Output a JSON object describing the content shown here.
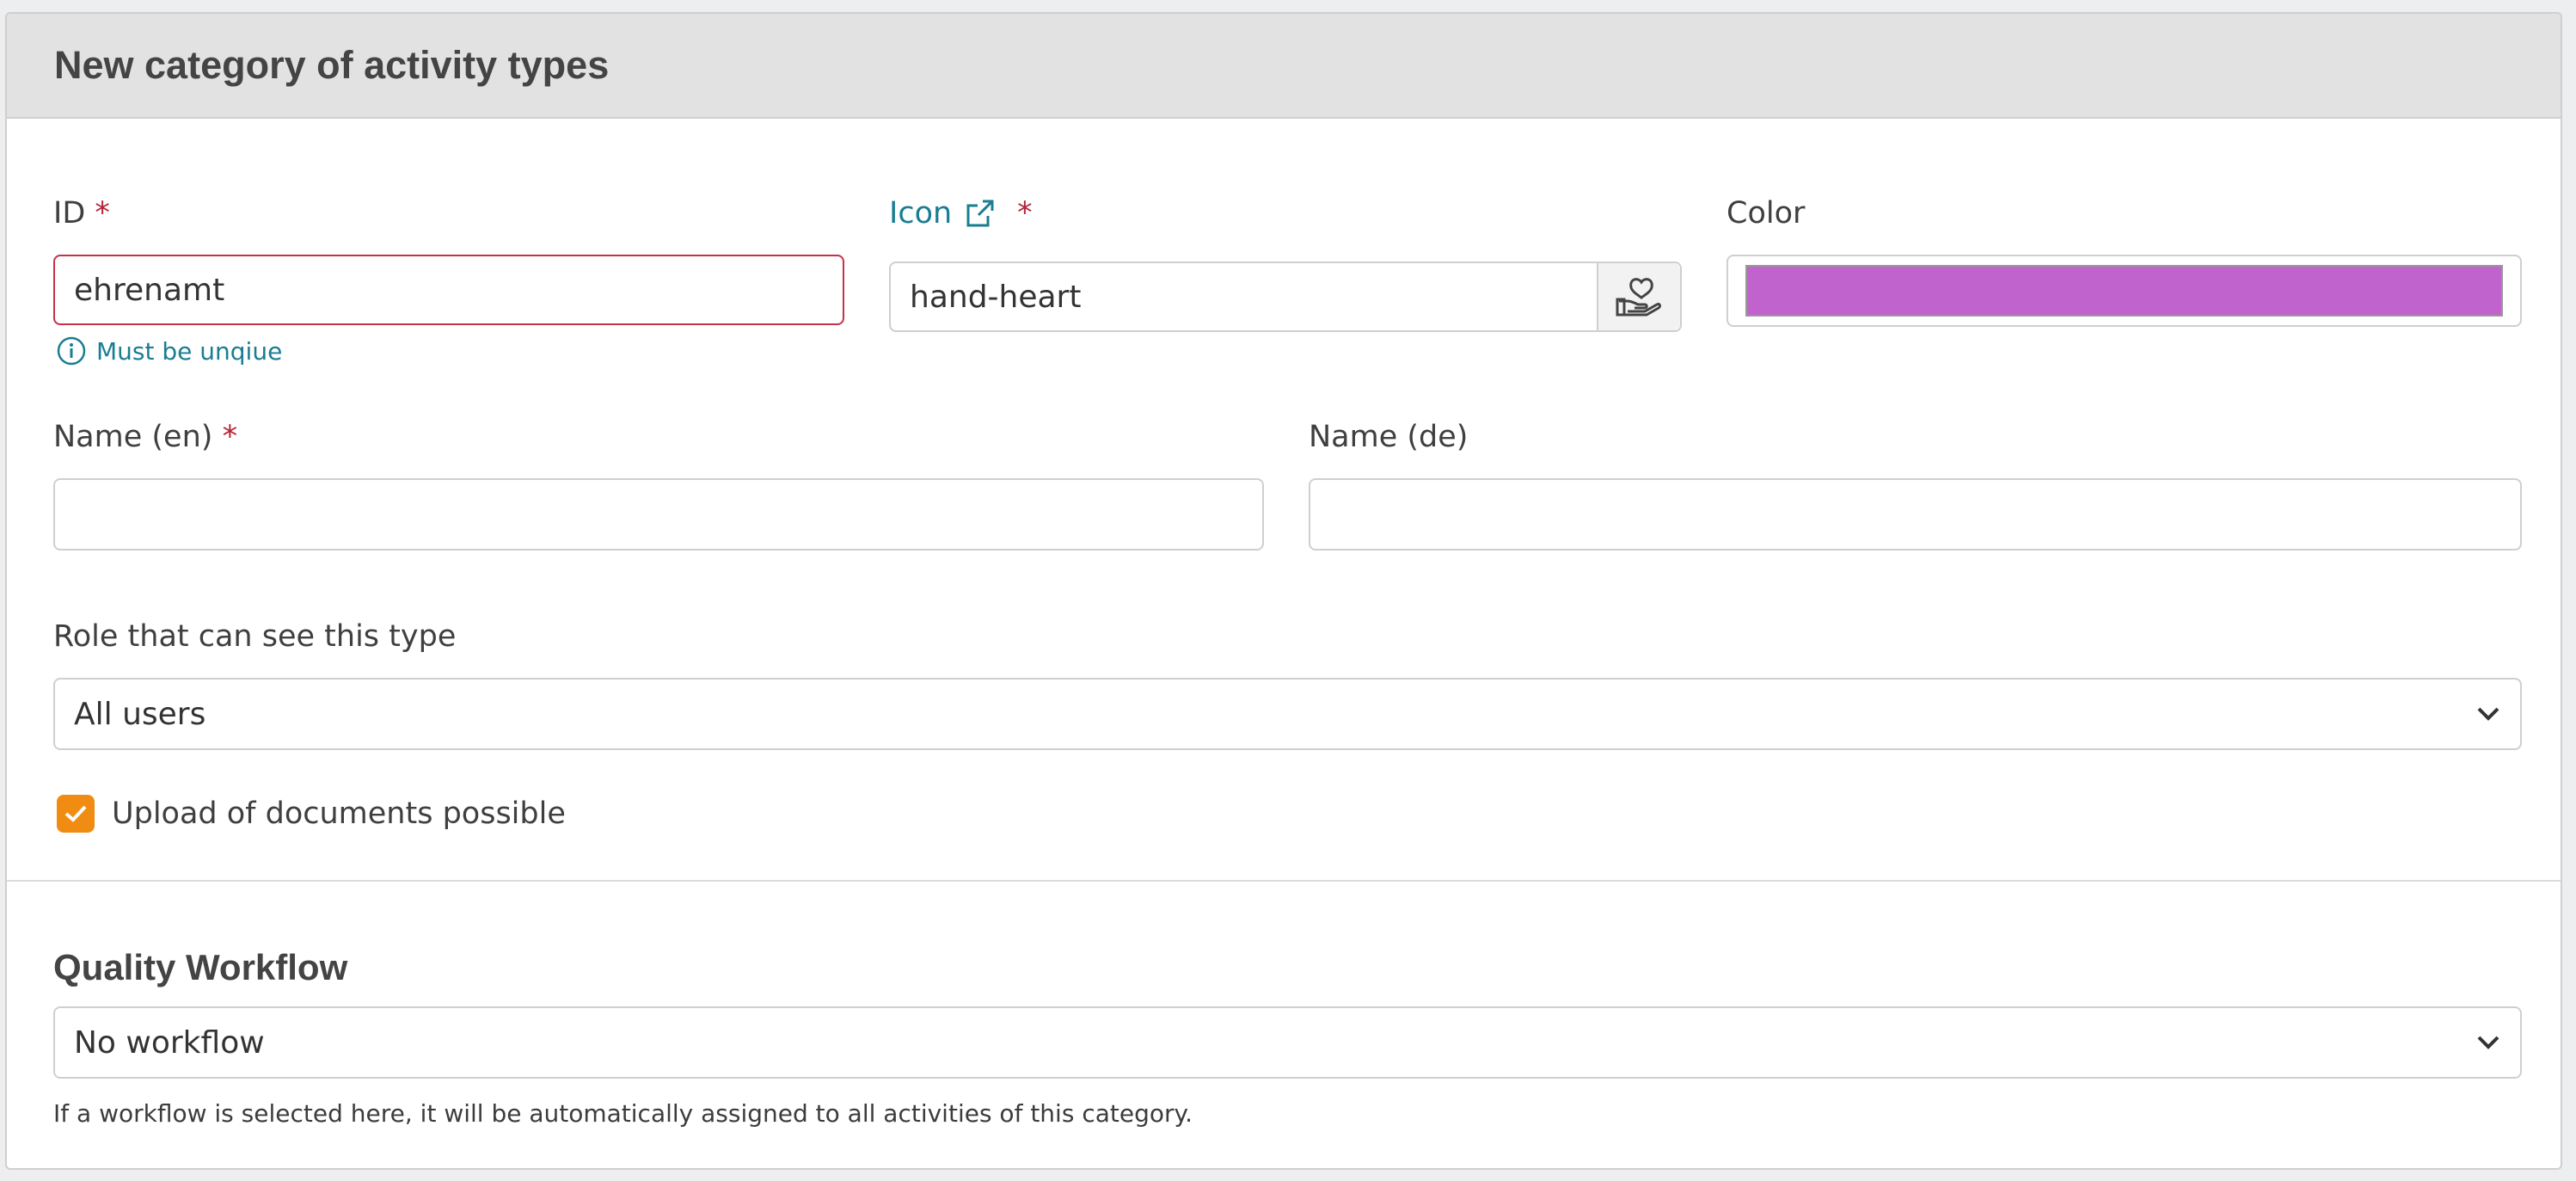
{
  "header": {
    "title": "New category of activity types"
  },
  "form": {
    "id": {
      "label": "ID",
      "required_mark": "*",
      "value": "ehrenamt",
      "helper": "Must be unqiue"
    },
    "icon": {
      "label": "Icon",
      "required_mark": "*",
      "value": "hand-heart",
      "preview_icon": "hand-heart-icon",
      "link_icon": "external-link-icon"
    },
    "color": {
      "label": "Color",
      "value": "#c063cd"
    },
    "name_en": {
      "label": "Name (en)",
      "required_mark": "*",
      "value": ""
    },
    "name_de": {
      "label": "Name (de)",
      "value": ""
    },
    "role": {
      "label": "Role that can see this type",
      "selected": "All users"
    },
    "upload": {
      "label": "Upload of documents possible",
      "checked": true
    }
  },
  "workflow": {
    "title": "Quality Workflow",
    "selected": "No workflow",
    "hint": "If a workflow is selected here, it will be automatically assigned to all activities of this category."
  },
  "colors": {
    "accent_link": "#1a7d92",
    "required": "#b4233a",
    "error_border": "#c63248",
    "checkbox": "#f08c12"
  }
}
